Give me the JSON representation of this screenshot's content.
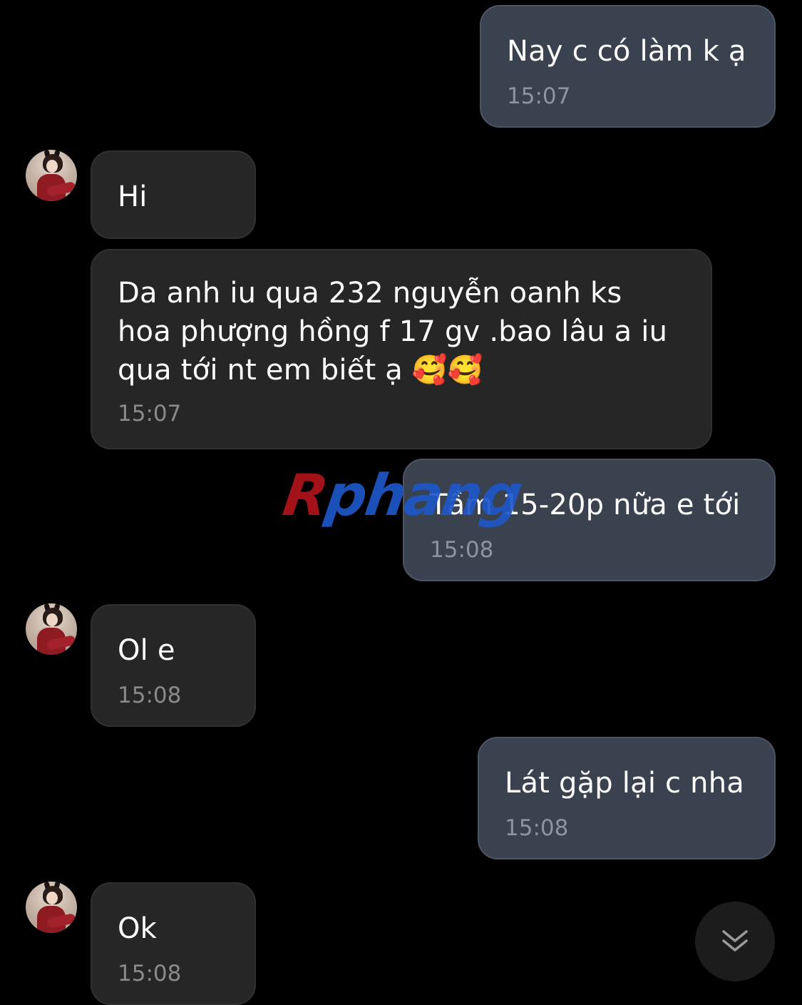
{
  "conversation": {
    "messages": [
      {
        "id": "m1",
        "direction": "outgoing",
        "text": "Nay c có làm k ạ",
        "time": "15:07"
      },
      {
        "id": "m2",
        "direction": "incoming",
        "text": "Hi",
        "time": ""
      },
      {
        "id": "m3",
        "direction": "incoming",
        "text": "Da anh iu qua 232 nguyễn oanh ks hoa phượng hồng f 17 gv .bao lâu a iu qua tới nt em biết ạ 🥰🥰",
        "time": "15:07"
      },
      {
        "id": "m4",
        "direction": "outgoing",
        "text": "Tầm 15-20p nữa e tới",
        "time": "15:08"
      },
      {
        "id": "m5",
        "direction": "incoming",
        "text": "Ol e",
        "time": "15:08"
      },
      {
        "id": "m6",
        "direction": "outgoing",
        "text": "Lát gặp lại c nha",
        "time": "15:08"
      },
      {
        "id": "m7",
        "direction": "incoming",
        "text": "Ok",
        "time": "15:08"
      }
    ]
  },
  "watermark": {
    "first_letter": "R",
    "rest": "phang"
  },
  "controls": {
    "scroll_down_icon": "double-chevron-down-icon"
  },
  "colors": {
    "background": "#000000",
    "outgoing_bubble": "#3a4250",
    "incoming_bubble": "#262626",
    "timestamp": "#8d949f",
    "watermark_red": "#b2141c",
    "watermark_blue": "#1e57c8"
  }
}
